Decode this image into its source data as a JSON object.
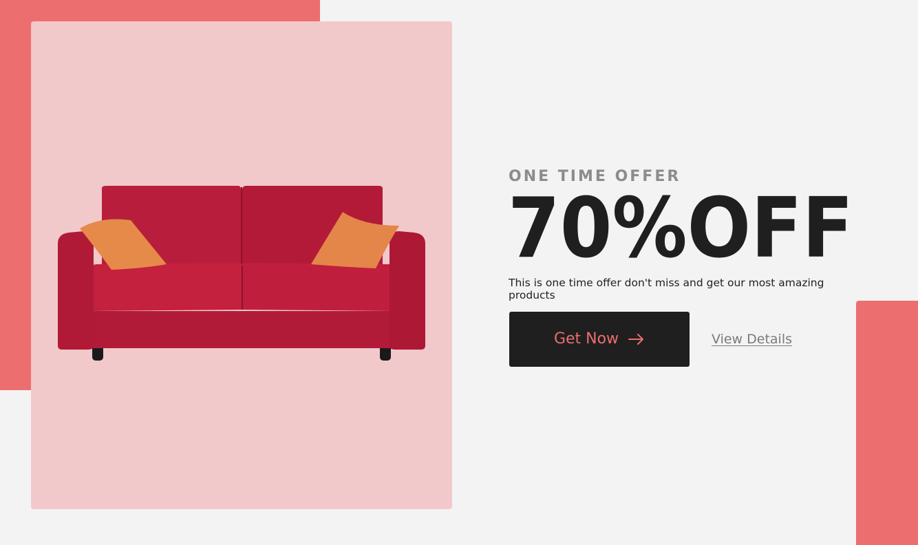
{
  "colors": {
    "accent": "#ec6e6e",
    "accent_light": "#f2c9cb",
    "background": "#f3f3f3",
    "dark": "#1f1f1f",
    "muted": "#8c8c8c"
  },
  "hero": {
    "eyebrow": "ONE TIME OFFER",
    "headline": "70%OFF",
    "description": "This is one time offer don't miss and get our most amazing products",
    "product_image": "red-sofa-image"
  },
  "actions": {
    "primary_label": "Get Now",
    "primary_icon": "arrow-right-icon",
    "secondary_label": "View Details"
  }
}
